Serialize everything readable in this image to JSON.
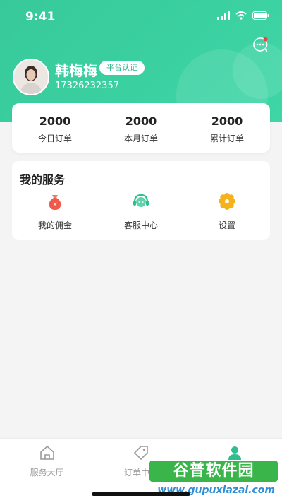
{
  "status_bar": {
    "time": "9:41"
  },
  "profile": {
    "name": "韩梅梅",
    "badge": "平台认证",
    "phone": "17326232357"
  },
  "stats": [
    {
      "value": "2000",
      "label": "今日订单"
    },
    {
      "value": "2000",
      "label": "本月订单"
    },
    {
      "value": "2000",
      "label": "累计订单"
    }
  ],
  "services": {
    "title": "我的服务",
    "items": [
      {
        "label": "我的佣金",
        "icon": "money-bag-icon"
      },
      {
        "label": "客服中心",
        "icon": "headset-icon"
      },
      {
        "label": "设置",
        "icon": "gear-icon"
      }
    ]
  },
  "tabbar": {
    "items": [
      {
        "label": "服务大厅",
        "icon": "home-icon"
      },
      {
        "label": "订单中心",
        "icon": "tag-icon"
      },
      {
        "label": "",
        "icon": "user-icon"
      }
    ]
  },
  "colors": {
    "accent": "#3ad1a0",
    "badge_text": "#27b788",
    "tab_active": "#2fbf8f",
    "notification": "#f04040"
  },
  "watermark": {
    "logo": "谷普软件园",
    "url": "www.gupuxlazai.com"
  }
}
